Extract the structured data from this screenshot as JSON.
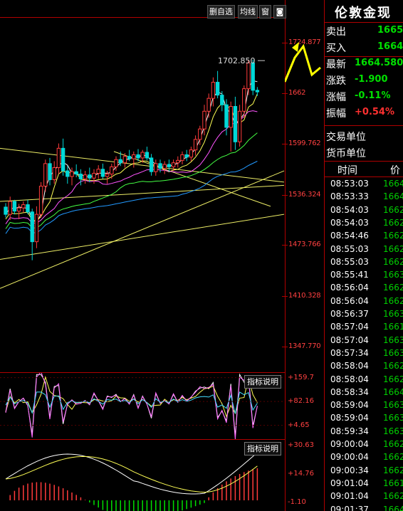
{
  "toolbar": {
    "delete_watchlist": "删自选",
    "avg_line": "均线",
    "window": "窗"
  },
  "instrument": {
    "title": "伦敦金现",
    "quotes": [
      {
        "label": "卖出",
        "value": "1665.",
        "color": "#00e000"
      },
      {
        "label": "买入",
        "value": "1664.",
        "color": "#00e000"
      },
      {
        "label": "最新",
        "value": "1664.580",
        "color": "#00e000"
      },
      {
        "label": "涨跌",
        "value": "-1.900",
        "color": "#00e000"
      },
      {
        "label": "涨幅",
        "value": "-0.11%",
        "color": "#00e000"
      },
      {
        "label": "振幅",
        "value": "+0.54%",
        "color": "#ff3030"
      }
    ],
    "info_rows": [
      {
        "label": "交易单位"
      },
      {
        "label": "货币单位"
      }
    ],
    "tick_header": {
      "time": "时间",
      "price": "价"
    }
  },
  "ticks": [
    {
      "time": "08:53:03",
      "price": "1664"
    },
    {
      "time": "08:53:33",
      "price": "1664"
    },
    {
      "time": "08:54:03",
      "price": "1662"
    },
    {
      "time": "08:54:03",
      "price": "1662"
    },
    {
      "time": "08:54:46",
      "price": "1662"
    },
    {
      "time": "08:55:03",
      "price": "1662"
    },
    {
      "time": "08:55:03",
      "price": "1662"
    },
    {
      "time": "08:55:41",
      "price": "1663"
    },
    {
      "time": "08:56:04",
      "price": "1662"
    },
    {
      "time": "08:56:04",
      "price": "1662"
    },
    {
      "time": "08:56:37",
      "price": "1663"
    },
    {
      "time": "08:57:04",
      "price": "1661"
    },
    {
      "time": "08:57:04",
      "price": "1663"
    },
    {
      "time": "08:57:34",
      "price": "1663"
    },
    {
      "time": "08:58:04",
      "price": "1662"
    },
    {
      "time": "08:58:04",
      "price": "1662"
    },
    {
      "time": "08:58:34",
      "price": "1664"
    },
    {
      "time": "08:59:04",
      "price": "1663"
    },
    {
      "time": "08:59:04",
      "price": "1663"
    },
    {
      "time": "08:59:34",
      "price": "1663"
    },
    {
      "time": "09:00:04",
      "price": "1662"
    },
    {
      "time": "09:00:04",
      "price": "1662"
    },
    {
      "time": "09:00:34",
      "price": "1662"
    },
    {
      "time": "09:01:04",
      "price": "1661"
    },
    {
      "time": "09:01:04",
      "price": "1662"
    },
    {
      "time": "09:01:37",
      "price": "1664"
    }
  ],
  "indicator_buttons": {
    "rsi": "指标说明",
    "macd": "指标说明"
  },
  "chart_data": {
    "type": "candlestick",
    "ylim": [
      1316.0,
      1756.0
    ],
    "y_ticks": [
      "1724.877",
      "1662",
      "1599.762",
      "1536.324",
      "1473.766",
      "1410.328",
      "1347.770"
    ],
    "y_tick_values": [
      1724.877,
      1662.0,
      1599.762,
      1536.324,
      1473.766,
      1410.328,
      1347.77
    ],
    "annotation": {
      "text": "1702.850",
      "value": 1702.85
    },
    "candles": [
      [
        1521,
        1526,
        1508,
        1512
      ],
      [
        1512,
        1534,
        1505,
        1528
      ],
      [
        1528,
        1530,
        1512,
        1516
      ],
      [
        1516,
        1525,
        1506,
        1520
      ],
      [
        1520,
        1528,
        1514,
        1524
      ],
      [
        1524,
        1530,
        1512,
        1515
      ],
      [
        1515,
        1519,
        1455,
        1478
      ],
      [
        1478,
        1522,
        1470,
        1512
      ],
      [
        1512,
        1552,
        1508,
        1547
      ],
      [
        1547,
        1580,
        1540,
        1575
      ],
      [
        1575,
        1582,
        1548,
        1555
      ],
      [
        1555,
        1578,
        1550,
        1570
      ],
      [
        1570,
        1600,
        1562,
        1594
      ],
      [
        1594,
        1606,
        1560,
        1566
      ],
      [
        1566,
        1572,
        1550,
        1559
      ],
      [
        1559,
        1570,
        1548,
        1565
      ],
      [
        1565,
        1574,
        1558,
        1562
      ],
      [
        1562,
        1568,
        1548,
        1556
      ],
      [
        1556,
        1566,
        1550,
        1561
      ],
      [
        1561,
        1570,
        1552,
        1557
      ],
      [
        1557,
        1568,
        1550,
        1563
      ],
      [
        1563,
        1573,
        1556,
        1568
      ],
      [
        1568,
        1575,
        1556,
        1559
      ],
      [
        1559,
        1566,
        1550,
        1562
      ],
      [
        1562,
        1575,
        1556,
        1571
      ],
      [
        1571,
        1584,
        1566,
        1580
      ],
      [
        1580,
        1590,
        1572,
        1576
      ],
      [
        1576,
        1588,
        1570,
        1584
      ],
      [
        1584,
        1592,
        1578,
        1581
      ],
      [
        1581,
        1590,
        1570,
        1586
      ],
      [
        1586,
        1593,
        1578,
        1582
      ],
      [
        1582,
        1592,
        1576,
        1589
      ],
      [
        1589,
        1596,
        1579,
        1582
      ],
      [
        1582,
        1587,
        1560,
        1565
      ],
      [
        1565,
        1580,
        1560,
        1575
      ],
      [
        1575,
        1580,
        1564,
        1569
      ],
      [
        1569,
        1578,
        1562,
        1574
      ],
      [
        1574,
        1580,
        1565,
        1571
      ],
      [
        1571,
        1580,
        1566,
        1576
      ],
      [
        1576,
        1584,
        1570,
        1579
      ],
      [
        1579,
        1590,
        1574,
        1586
      ],
      [
        1586,
        1592,
        1578,
        1583
      ],
      [
        1583,
        1596,
        1578,
        1592
      ],
      [
        1592,
        1610,
        1585,
        1605
      ],
      [
        1605,
        1622,
        1598,
        1618
      ],
      [
        1618,
        1648,
        1610,
        1640
      ],
      [
        1640,
        1662,
        1632,
        1656
      ],
      [
        1656,
        1682,
        1646,
        1676
      ],
      [
        1676,
        1690,
        1656,
        1660
      ],
      [
        1660,
        1665,
        1640,
        1648
      ],
      [
        1648,
        1655,
        1610,
        1620
      ],
      [
        1620,
        1652,
        1590,
        1646
      ],
      [
        1646,
        1658,
        1592,
        1602
      ],
      [
        1602,
        1648,
        1596,
        1640
      ],
      [
        1640,
        1672,
        1632,
        1668
      ],
      [
        1668,
        1704,
        1660,
        1700
      ],
      [
        1700,
        1704,
        1660,
        1666
      ],
      [
        1666,
        1670,
        1659,
        1664
      ]
    ],
    "sub1_ticks": [
      "+159.7",
      "+82.16",
      "+4.65"
    ],
    "sub1_tick_values": [
      159.7,
      82.16,
      4.65
    ],
    "sub1_ylim": [
      -40,
      175
    ],
    "sub2_ticks": [
      "+30.63",
      "+14.76",
      "-1.10"
    ],
    "sub2_tick_values": [
      30.63,
      14.76,
      -1.1
    ],
    "sub2_ylim": [
      -6,
      34
    ],
    "colors": {
      "up": "#ff3b3b",
      "down": "#00d8d8",
      "ma": [
        "#ffffff",
        "#ffff55",
        "#ff55ff",
        "#44ff44",
        "#2299ff"
      ],
      "grid": "#b00000"
    }
  }
}
